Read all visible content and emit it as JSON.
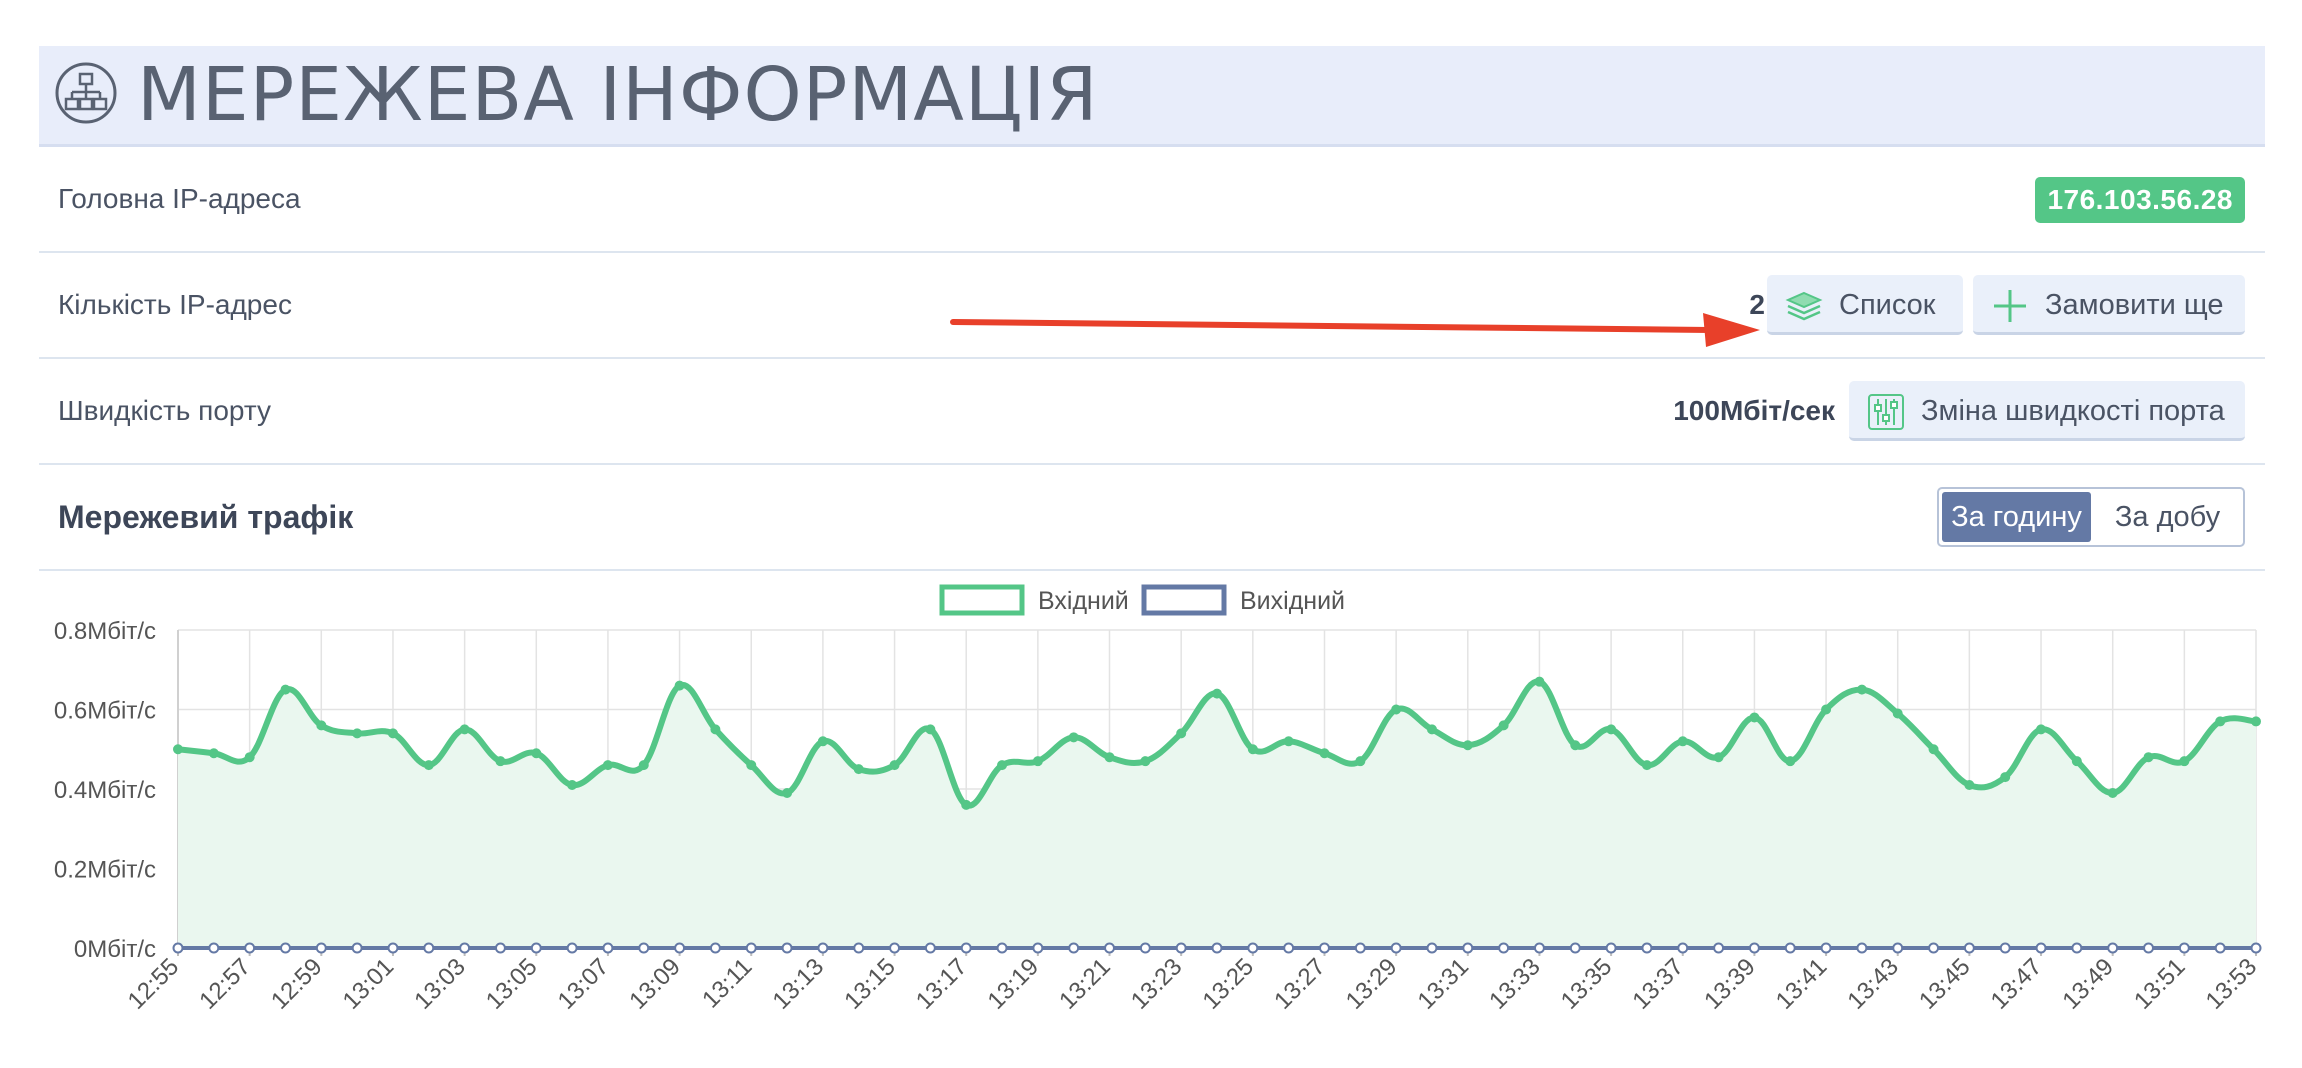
{
  "header": {
    "title": "МЕРЕЖЕВА ІНФОРМАЦІЯ",
    "icon": "network-icon"
  },
  "rows": {
    "main_ip": {
      "label": "Головна IP-адреса",
      "value": "176.103.56.28"
    },
    "ip_count": {
      "label": "Кількість IP-адрес",
      "value": "2",
      "list_button": "Список",
      "order_button": "Замовити ще"
    },
    "port_speed": {
      "label": "Швидкість порту",
      "value": "100Мбіт/сек",
      "change_button": "Зміна швидкості порта"
    }
  },
  "traffic": {
    "title": "Мережевий трафік",
    "toggle": {
      "hour": "За годину",
      "day": "За добу",
      "selected": "hour"
    }
  },
  "colors": {
    "incoming": "#54c687",
    "outgoing": "#6479a5",
    "badge": "#54c687",
    "arrow": "#e8402a",
    "header_bg": "#e8edfa"
  },
  "chart_data": {
    "type": "line",
    "legend": [
      "Вхідний",
      "Вихідний"
    ],
    "y_ticks": [
      "0Мбіт/с",
      "0.2Мбіт/с",
      "0.4Мбіт/с",
      "0.6Мбіт/с",
      "0.8Мбіт/с"
    ],
    "ylim": [
      0,
      0.8
    ],
    "x": [
      "12:55",
      "12:56",
      "12:57",
      "12:58",
      "12:59",
      "13:00",
      "13:01",
      "13:02",
      "13:03",
      "13:04",
      "13:05",
      "13:06",
      "13:07",
      "13:08",
      "13:09",
      "13:10",
      "13:11",
      "13:12",
      "13:13",
      "13:14",
      "13:15",
      "13:16",
      "13:17",
      "13:18",
      "13:19",
      "13:20",
      "13:21",
      "13:22",
      "13:23",
      "13:24",
      "13:25",
      "13:26",
      "13:27",
      "13:28",
      "13:29",
      "13:30",
      "13:31",
      "13:32",
      "13:33",
      "13:34",
      "13:35",
      "13:36",
      "13:37",
      "13:38",
      "13:39",
      "13:40",
      "13:41",
      "13:42",
      "13:43",
      "13:44",
      "13:45",
      "13:46",
      "13:47",
      "13:48",
      "13:49",
      "13:50",
      "13:51",
      "13:52",
      "13:53"
    ],
    "x_tick_labels": [
      "12:55",
      "12:57",
      "12:59",
      "13:01",
      "13:03",
      "13:05",
      "13:07",
      "13:09",
      "13:11",
      "13:13",
      "13:15",
      "13:17",
      "13:19",
      "13:21",
      "13:23",
      "13:25",
      "13:27",
      "13:29",
      "13:31",
      "13:33",
      "13:35",
      "13:37",
      "13:39",
      "13:41",
      "13:43",
      "13:45",
      "13:47",
      "13:49",
      "13:51",
      "13:53"
    ],
    "series": [
      {
        "name": "Вхідний",
        "values": [
          0.5,
          0.49,
          0.48,
          0.65,
          0.56,
          0.54,
          0.54,
          0.46,
          0.55,
          0.47,
          0.49,
          0.41,
          0.46,
          0.46,
          0.66,
          0.55,
          0.46,
          0.39,
          0.52,
          0.45,
          0.46,
          0.55,
          0.36,
          0.46,
          0.47,
          0.53,
          0.48,
          0.47,
          0.54,
          0.64,
          0.5,
          0.52,
          0.49,
          0.47,
          0.6,
          0.55,
          0.51,
          0.56,
          0.67,
          0.51,
          0.55,
          0.46,
          0.52,
          0.48,
          0.58,
          0.47,
          0.6,
          0.65,
          0.59,
          0.5,
          0.41,
          0.43,
          0.55,
          0.47,
          0.39,
          0.48,
          0.47,
          0.57,
          0.57
        ]
      },
      {
        "name": "Вихідний",
        "values": [
          0,
          0,
          0,
          0,
          0,
          0,
          0,
          0,
          0,
          0,
          0,
          0,
          0,
          0,
          0,
          0,
          0,
          0,
          0,
          0,
          0,
          0,
          0,
          0,
          0,
          0,
          0,
          0,
          0,
          0,
          0,
          0,
          0,
          0,
          0,
          0,
          0,
          0,
          0,
          0,
          0,
          0,
          0,
          0,
          0,
          0,
          0,
          0,
          0,
          0,
          0,
          0,
          0,
          0,
          0,
          0,
          0,
          0,
          0
        ]
      }
    ],
    "grid": true
  }
}
